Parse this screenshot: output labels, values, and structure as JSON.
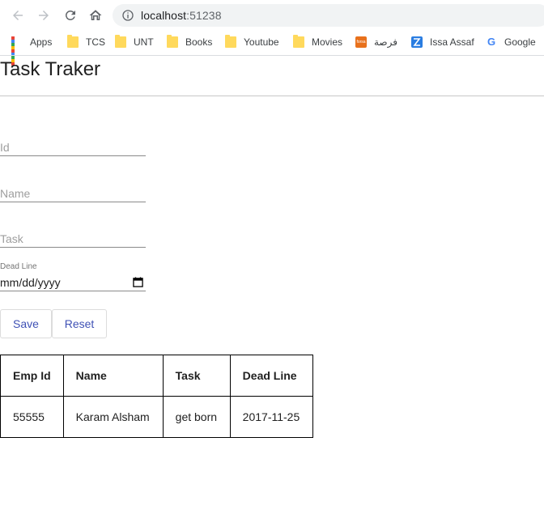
{
  "browser": {
    "url_host": "localhost",
    "url_port": ":51238",
    "bookmarks": [
      {
        "label": "Apps",
        "icon": "apps-grid-icon"
      },
      {
        "label": "TCS",
        "icon": "folder-icon"
      },
      {
        "label": "UNT",
        "icon": "folder-icon"
      },
      {
        "label": "Books",
        "icon": "folder-icon"
      },
      {
        "label": "Youtube",
        "icon": "folder-icon"
      },
      {
        "label": "Movies",
        "icon": "folder-icon"
      },
      {
        "label": "فرصة",
        "icon": "forsa-favicon",
        "favicon_text": "forsa"
      },
      {
        "label": "Issa Assaf",
        "icon": "issa-assaf-favicon"
      },
      {
        "label": "Google",
        "icon": "google-favicon",
        "favicon_text": "G"
      }
    ]
  },
  "page": {
    "title": "Task Traker",
    "form": {
      "id_placeholder": "Id",
      "name_placeholder": "Name",
      "task_placeholder": "Task",
      "deadline_label": "Dead Line",
      "deadline_placeholder": "mm/dd/yyyy",
      "save_label": "Save",
      "reset_label": "Reset"
    },
    "table": {
      "headers": [
        "Emp Id",
        "Name",
        "Task",
        "Dead Line"
      ],
      "rows": [
        [
          "55555",
          "Karam Alsham",
          "get born",
          "2017-11-25"
        ]
      ]
    }
  },
  "colors": {
    "accent": "#3f51b5",
    "folder": "#ffd95c",
    "omnibox": "#f1f3f4"
  }
}
